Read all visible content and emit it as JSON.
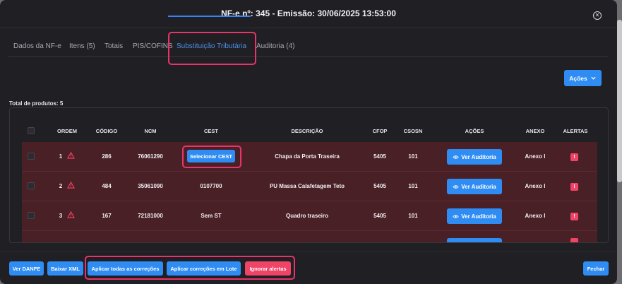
{
  "title": "NF-e nº: 345 - Emissão: 30/06/2025 13:53:00",
  "close_icon": "close-circle-icon",
  "tabs": [
    {
      "label": "Dados da NF-e"
    },
    {
      "label": "Itens (5)"
    },
    {
      "label": "Totais"
    },
    {
      "label": "PIS/COFINS"
    },
    {
      "label": "Substituição Tributária",
      "active": true
    },
    {
      "label": "Auditoria (4)"
    }
  ],
  "actions_button": "Ações",
  "total_label": "Total de produtos: 5",
  "columns": {
    "ordem": "ORDEM",
    "codigo": "CÓDIGO",
    "ncm": "NCM",
    "cest": "CEST",
    "descricao": "DESCRIÇÃO",
    "cfop": "CFOP",
    "csosn": "CSOSN",
    "acoes": "AÇÕES",
    "anexo": "ANEXO",
    "alertas": "ALERTAS"
  },
  "rows": [
    {
      "ordem": "1",
      "codigo": "286",
      "ncm": "76061290",
      "cest": "Selecionar CEST",
      "descricao": "Chapa da Porta Traseira",
      "cfop": "5405",
      "csosn": "101",
      "acao": "Ver Auditoria",
      "anexo": "Anexo I",
      "alerta": "!"
    },
    {
      "ordem": "2",
      "codigo": "484",
      "ncm": "35061090",
      "cest": "0107700",
      "descricao": "PU Massa Calafetagem Teto",
      "cfop": "5405",
      "csosn": "101",
      "acao": "Ver Auditoria",
      "anexo": "Anexo I",
      "alerta": "!"
    },
    {
      "ordem": "3",
      "codigo": "167",
      "ncm": "72181000",
      "cest": "Sem ST",
      "descricao": "Quadro traseiro",
      "cfop": "5405",
      "csosn": "101",
      "acao": "Ver Auditoria",
      "anexo": "Anexo I",
      "alerta": "!"
    }
  ],
  "footer": {
    "ver_danfe": "Ver DANFE",
    "baixar_xml": "Baixar XML",
    "aplicar_todas": "Aplicar todas as correções",
    "aplicar_lote": "Aplicar correções em Lote",
    "ignorar": "Ignorar alertas",
    "fechar": "Fechar"
  },
  "colors": {
    "accent": "#2f8cf3",
    "danger": "#ef4466",
    "row_alert": "#4a2027",
    "highlight": "#e8346a"
  }
}
